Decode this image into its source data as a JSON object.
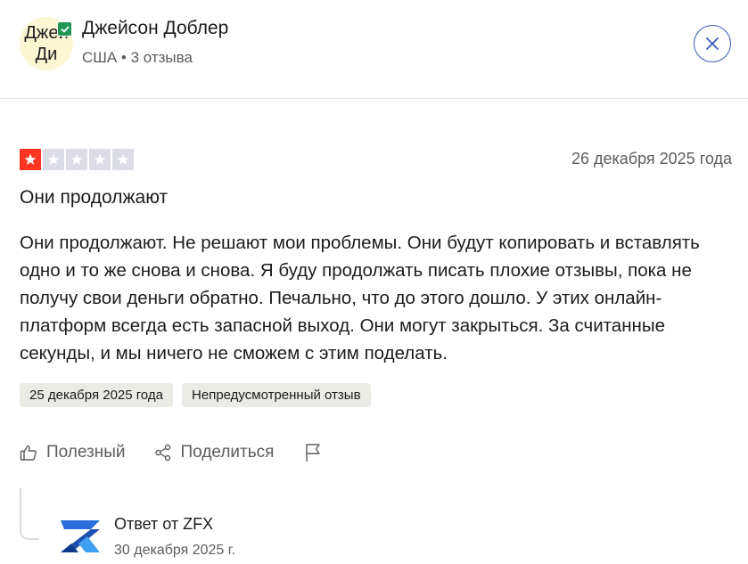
{
  "reviewer": {
    "initials": "Джей Ди",
    "name": "Джейсон Доблер",
    "meta": "США • 3 отзыва"
  },
  "review": {
    "rating": 1,
    "max_rating": 5,
    "date": "26 декабря 2025 года",
    "title": "Они продолжают",
    "text": "Они продолжают. Не решают мои проблемы. Они будут копировать и вставлять одно и то же снова и снова. Я буду продолжать писать плохие отзывы, пока не получу свои деньги обратно. Печально, что до этого дошло. У этих онлайн-платформ всегда есть запасной выход. Они могут закрыться. За считанные секунды, и мы ничего не сможем с этим поделать.",
    "tags": [
      "25 декабря 2025 года",
      "Непредусмотренный отзыв"
    ]
  },
  "actions": {
    "useful_label": "Полезный",
    "share_label": "Поделиться"
  },
  "reply": {
    "from": "Ответ от ZFX",
    "date": "30 декабря 2025 г."
  },
  "colors": {
    "star_active": "#ff3722",
    "star_inactive": "#dcdce6",
    "close_accent": "#3c57bc",
    "verified": "#219653",
    "avatar_bg": "#fdf6d3"
  },
  "icons": [
    "verified-check-icon",
    "close-icon",
    "star-icon",
    "thumbs-up-icon",
    "share-icon",
    "flag-icon",
    "zfx-logo"
  ]
}
